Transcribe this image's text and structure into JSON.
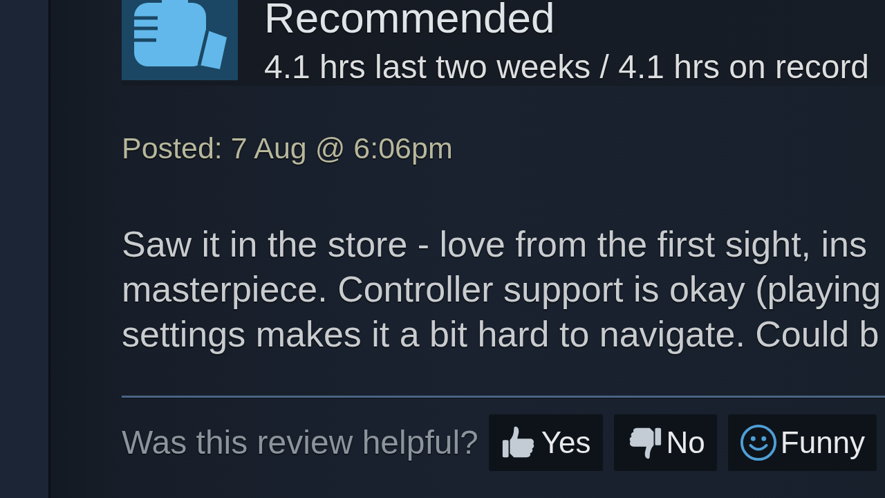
{
  "review": {
    "recommended": true,
    "verdict": "Recommended",
    "hours": "4.1 hrs last two weeks / 4.1 hrs on record",
    "posted": "Posted: 7 Aug @ 6:06pm",
    "text_lines": [
      "Saw it in the store - love from the first sight, ins",
      "masterpiece. Controller support is okay (playing",
      "settings makes it a bit hard to navigate. Could b"
    ]
  },
  "helpful": {
    "prompt": "Was this review helpful?",
    "buttons": [
      {
        "kind": "yes",
        "label": "Yes"
      },
      {
        "kind": "no",
        "label": "No"
      },
      {
        "kind": "funny",
        "label": "Funny"
      }
    ]
  }
}
